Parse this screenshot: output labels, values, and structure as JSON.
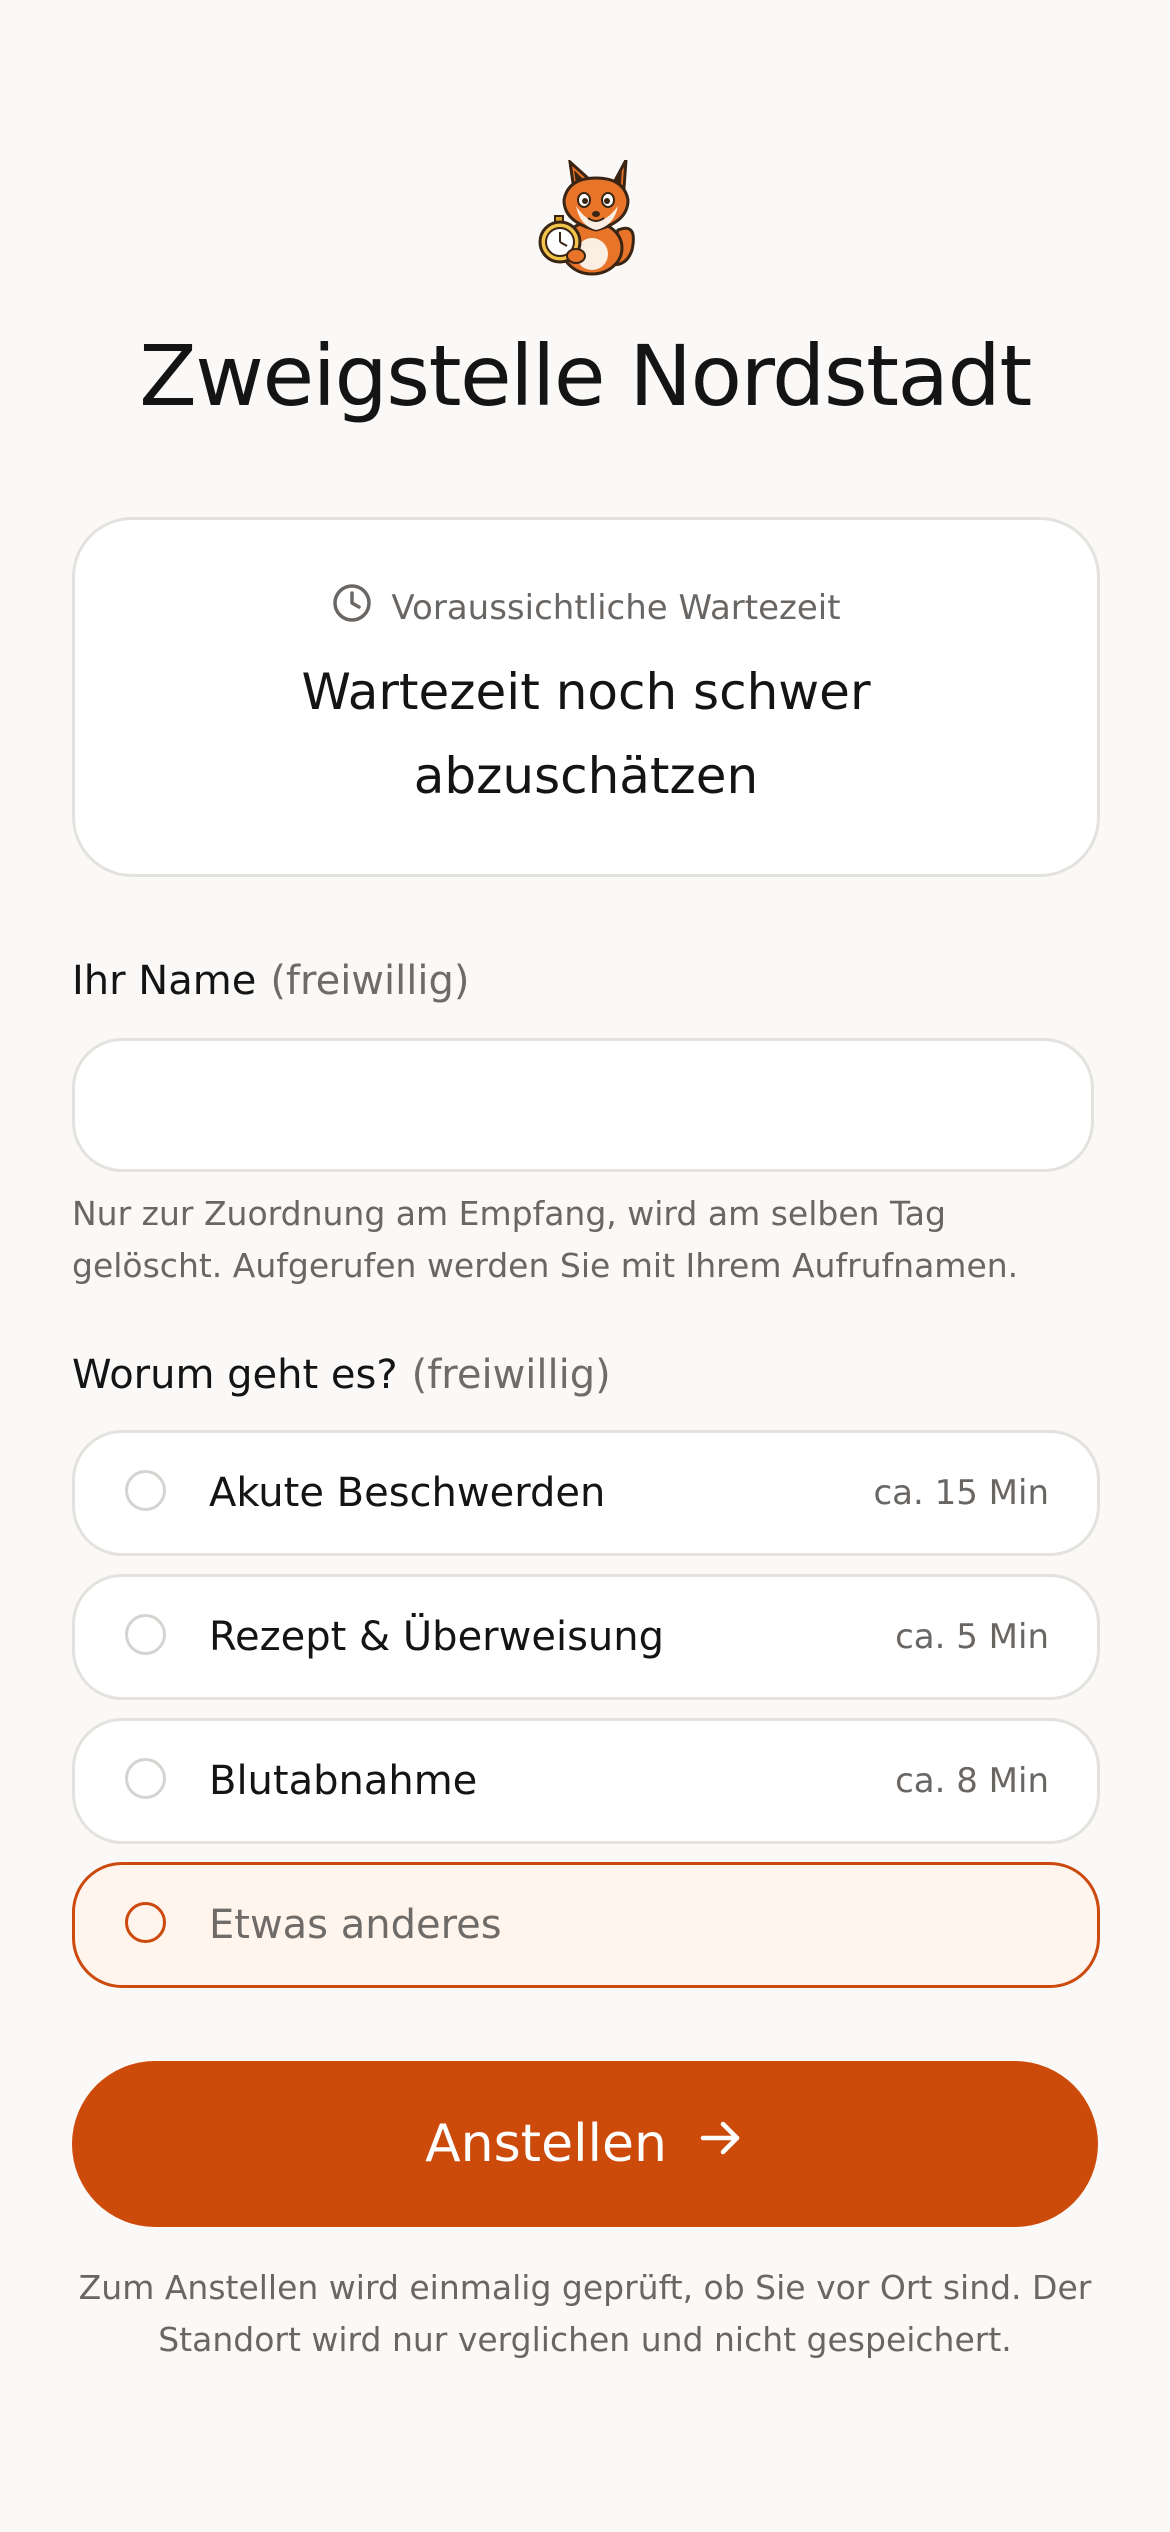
{
  "header": {
    "logo_icon": "fox-with-stopwatch-icon",
    "title": "Zweigstelle Nordstadt"
  },
  "wait_card": {
    "icon": "clock-icon",
    "label": "Voraussichtliche Wartezeit",
    "value": "Wartezeit noch schwer abzuschätzen"
  },
  "name_field": {
    "label": "Ihr Name",
    "optional_tag": "(freiwillig)",
    "value": "",
    "placeholder": "",
    "hint": "Nur zur Zuordnung am Empfang, wird am selben Tag gelöscht. Aufgerufen werden Sie mit Ihrem Aufrufnamen."
  },
  "reason_field": {
    "label": "Worum geht es?",
    "optional_tag": "(freiwillig)",
    "options": [
      {
        "label": "Akute Beschwerden",
        "time": "ca. 15 Min",
        "selected": false
      },
      {
        "label": "Rezept & Überweisung",
        "time": "ca. 5 Min",
        "selected": false
      },
      {
        "label": "Blutabnahme",
        "time": "ca. 8 Min",
        "selected": false
      },
      {
        "label": "Etwas anderes",
        "time": "",
        "selected": true
      }
    ]
  },
  "submit": {
    "label": "Anstellen",
    "icon": "arrow-right-icon"
  },
  "footnote": "Zum Anstellen wird einmalig geprüft, ob Sie vor Ort sind. Der Standort wird nur verglichen und nicht gespeichert.",
  "colors": {
    "accent": "#cc4a0a",
    "background": "#faf9f7",
    "selected_bg": "#fff5ec"
  }
}
